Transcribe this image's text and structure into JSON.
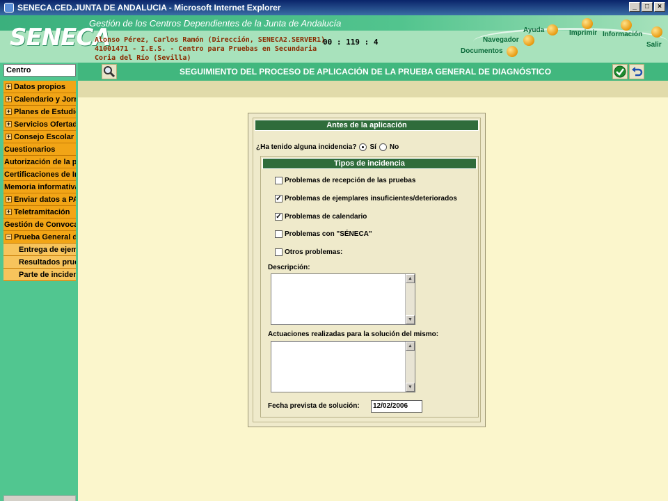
{
  "window": {
    "title": "SENECA.CED.JUNTA DE ANDALUCIA - Microsoft Internet Explorer",
    "buttons": [
      "_",
      "□",
      "×"
    ]
  },
  "header": {
    "logo": "SENECA",
    "title": "Gestión de los Centros Dependientes de la Junta de Andalucía",
    "user_line1": "Alonso Pérez, Carlos Ramón (Dirección, SENECA2.SERVER1)",
    "user_line2": "41001471 - I.E.S. - Centro para Pruebas en Secundaria",
    "user_line3": "Coria del Río (Sevilla)",
    "clock": "00 : 119 : 4",
    "nav": {
      "ayuda": "Ayuda",
      "imprimir": "Imprimir",
      "informacion": "Información",
      "navegador": "Navegador",
      "salir": "Salir",
      "documentos": "Documentos"
    }
  },
  "sidebar": {
    "centro_label": "Centro",
    "items": [
      {
        "label": "Datos propios",
        "expander": "+"
      },
      {
        "label": "Calendario y Jornada",
        "expander": "+"
      },
      {
        "label": "Planes de Estudio",
        "expander": "+"
      },
      {
        "label": "Servicios Ofertados",
        "expander": "+"
      },
      {
        "label": "Consejo Escolar",
        "expander": "+"
      },
      {
        "label": "Cuestionarios",
        "expander": ""
      },
      {
        "label": "Autorización de la pla",
        "expander": ""
      },
      {
        "label": "Certificaciones de In",
        "expander": ""
      },
      {
        "label": "Memoria informativa",
        "expander": ""
      },
      {
        "label": "Enviar datos a PAS",
        "expander": "+"
      },
      {
        "label": "Teletramitación",
        "expander": "+"
      },
      {
        "label": "Gestión de Convocato",
        "expander": ""
      },
      {
        "label": "Prueba General de",
        "expander": "−"
      }
    ],
    "subitems": [
      {
        "label": "Entrega de ejemplares"
      },
      {
        "label": "Resultados pruebas"
      },
      {
        "label": "Parte de incidencias"
      }
    ]
  },
  "toolbar": {
    "page_title": "SEGUIMIENTO DEL PROCESO DE APLICACIÓN DE LA PRUEBA GENERAL DE DIAGNÓSTICO"
  },
  "form": {
    "section_title": "Antes de la aplicación",
    "question": "¿Ha tenido alguna incidencia?",
    "radio_si": "Sí",
    "radio_no": "No",
    "selected": "Sí",
    "tipos_title": "Tipos de incidencia",
    "checkboxes": [
      {
        "label": "Problemas de recepción de las pruebas",
        "checked": false,
        "mark": ""
      },
      {
        "label": "Problemas de ejemplares insuficientes/deteriorados",
        "checked": true,
        "mark": "✓"
      },
      {
        "label": "Problemas de calendario",
        "checked": true,
        "mark": "✓"
      },
      {
        "label": "Problemas con \"SÉNECA\"",
        "checked": false,
        "mark": ""
      },
      {
        "label": "Otros problemas:",
        "checked": false,
        "mark": ""
      }
    ],
    "descripcion_label": "Descripción:",
    "descripcion_value": "",
    "actuaciones_label": "Actuaciones realizadas para la solución del mismo:",
    "actuaciones_value": "",
    "fecha_label": "Fecha prevista de solución:",
    "fecha_value": "12/02/2006"
  },
  "colors": {
    "header_green": "#a8e2bc",
    "sidebar_green": "#51c690",
    "menu_orange": "#f2a516",
    "section_green": "#2f6c3b",
    "main_bg": "#fbf6cc"
  }
}
